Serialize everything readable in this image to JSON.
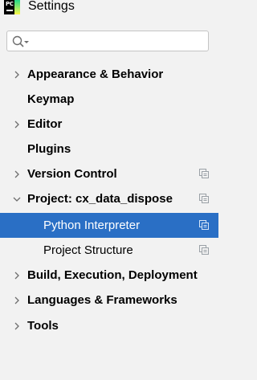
{
  "window": {
    "title": "Settings",
    "app_icon_text": "PC"
  },
  "search": {
    "value": "",
    "placeholder": "",
    "icon": "search-icon"
  },
  "tree": {
    "items": [
      {
        "label": "Appearance & Behavior",
        "expandable": true,
        "expanded": false,
        "has_copy_icon": false
      },
      {
        "label": "Keymap",
        "expandable": false,
        "has_copy_icon": false
      },
      {
        "label": "Editor",
        "expandable": true,
        "expanded": false,
        "has_copy_icon": false
      },
      {
        "label": "Plugins",
        "expandable": false,
        "has_copy_icon": false
      },
      {
        "label": "Version Control",
        "expandable": true,
        "expanded": false,
        "has_copy_icon": true
      },
      {
        "label": "Project: cx_data_dispose",
        "expandable": true,
        "expanded": true,
        "has_copy_icon": true,
        "children": [
          {
            "label": "Python Interpreter",
            "selected": true,
            "has_copy_icon": true
          },
          {
            "label": "Project Structure",
            "selected": false,
            "has_copy_icon": true
          }
        ]
      },
      {
        "label": "Build, Execution, Deployment",
        "expandable": true,
        "expanded": false,
        "has_copy_icon": false
      },
      {
        "label": "Languages & Frameworks",
        "expandable": true,
        "expanded": false,
        "has_copy_icon": false
      },
      {
        "label": "Tools",
        "expandable": true,
        "expanded": false,
        "has_copy_icon": false
      }
    ]
  },
  "colors": {
    "background": "#f2f2f2",
    "selection": "#2a6fc5",
    "chevron": "#6e6e6e",
    "copy_icon": "#9aa0a6"
  }
}
